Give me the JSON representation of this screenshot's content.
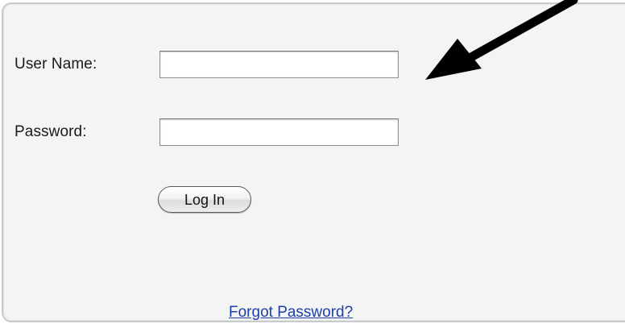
{
  "login_form": {
    "username_label": "User Name:",
    "username_value": "",
    "password_label": "Password:",
    "password_value": "",
    "login_button_label": "Log In",
    "forgot_password_link": "Forgot Password?"
  },
  "annotation": {
    "icon": "arrow-icon",
    "color": "#000000"
  },
  "colors": {
    "panel_background": "#f3f4f4",
    "panel_border": "#c9caca",
    "link": "#1f3fa6"
  }
}
